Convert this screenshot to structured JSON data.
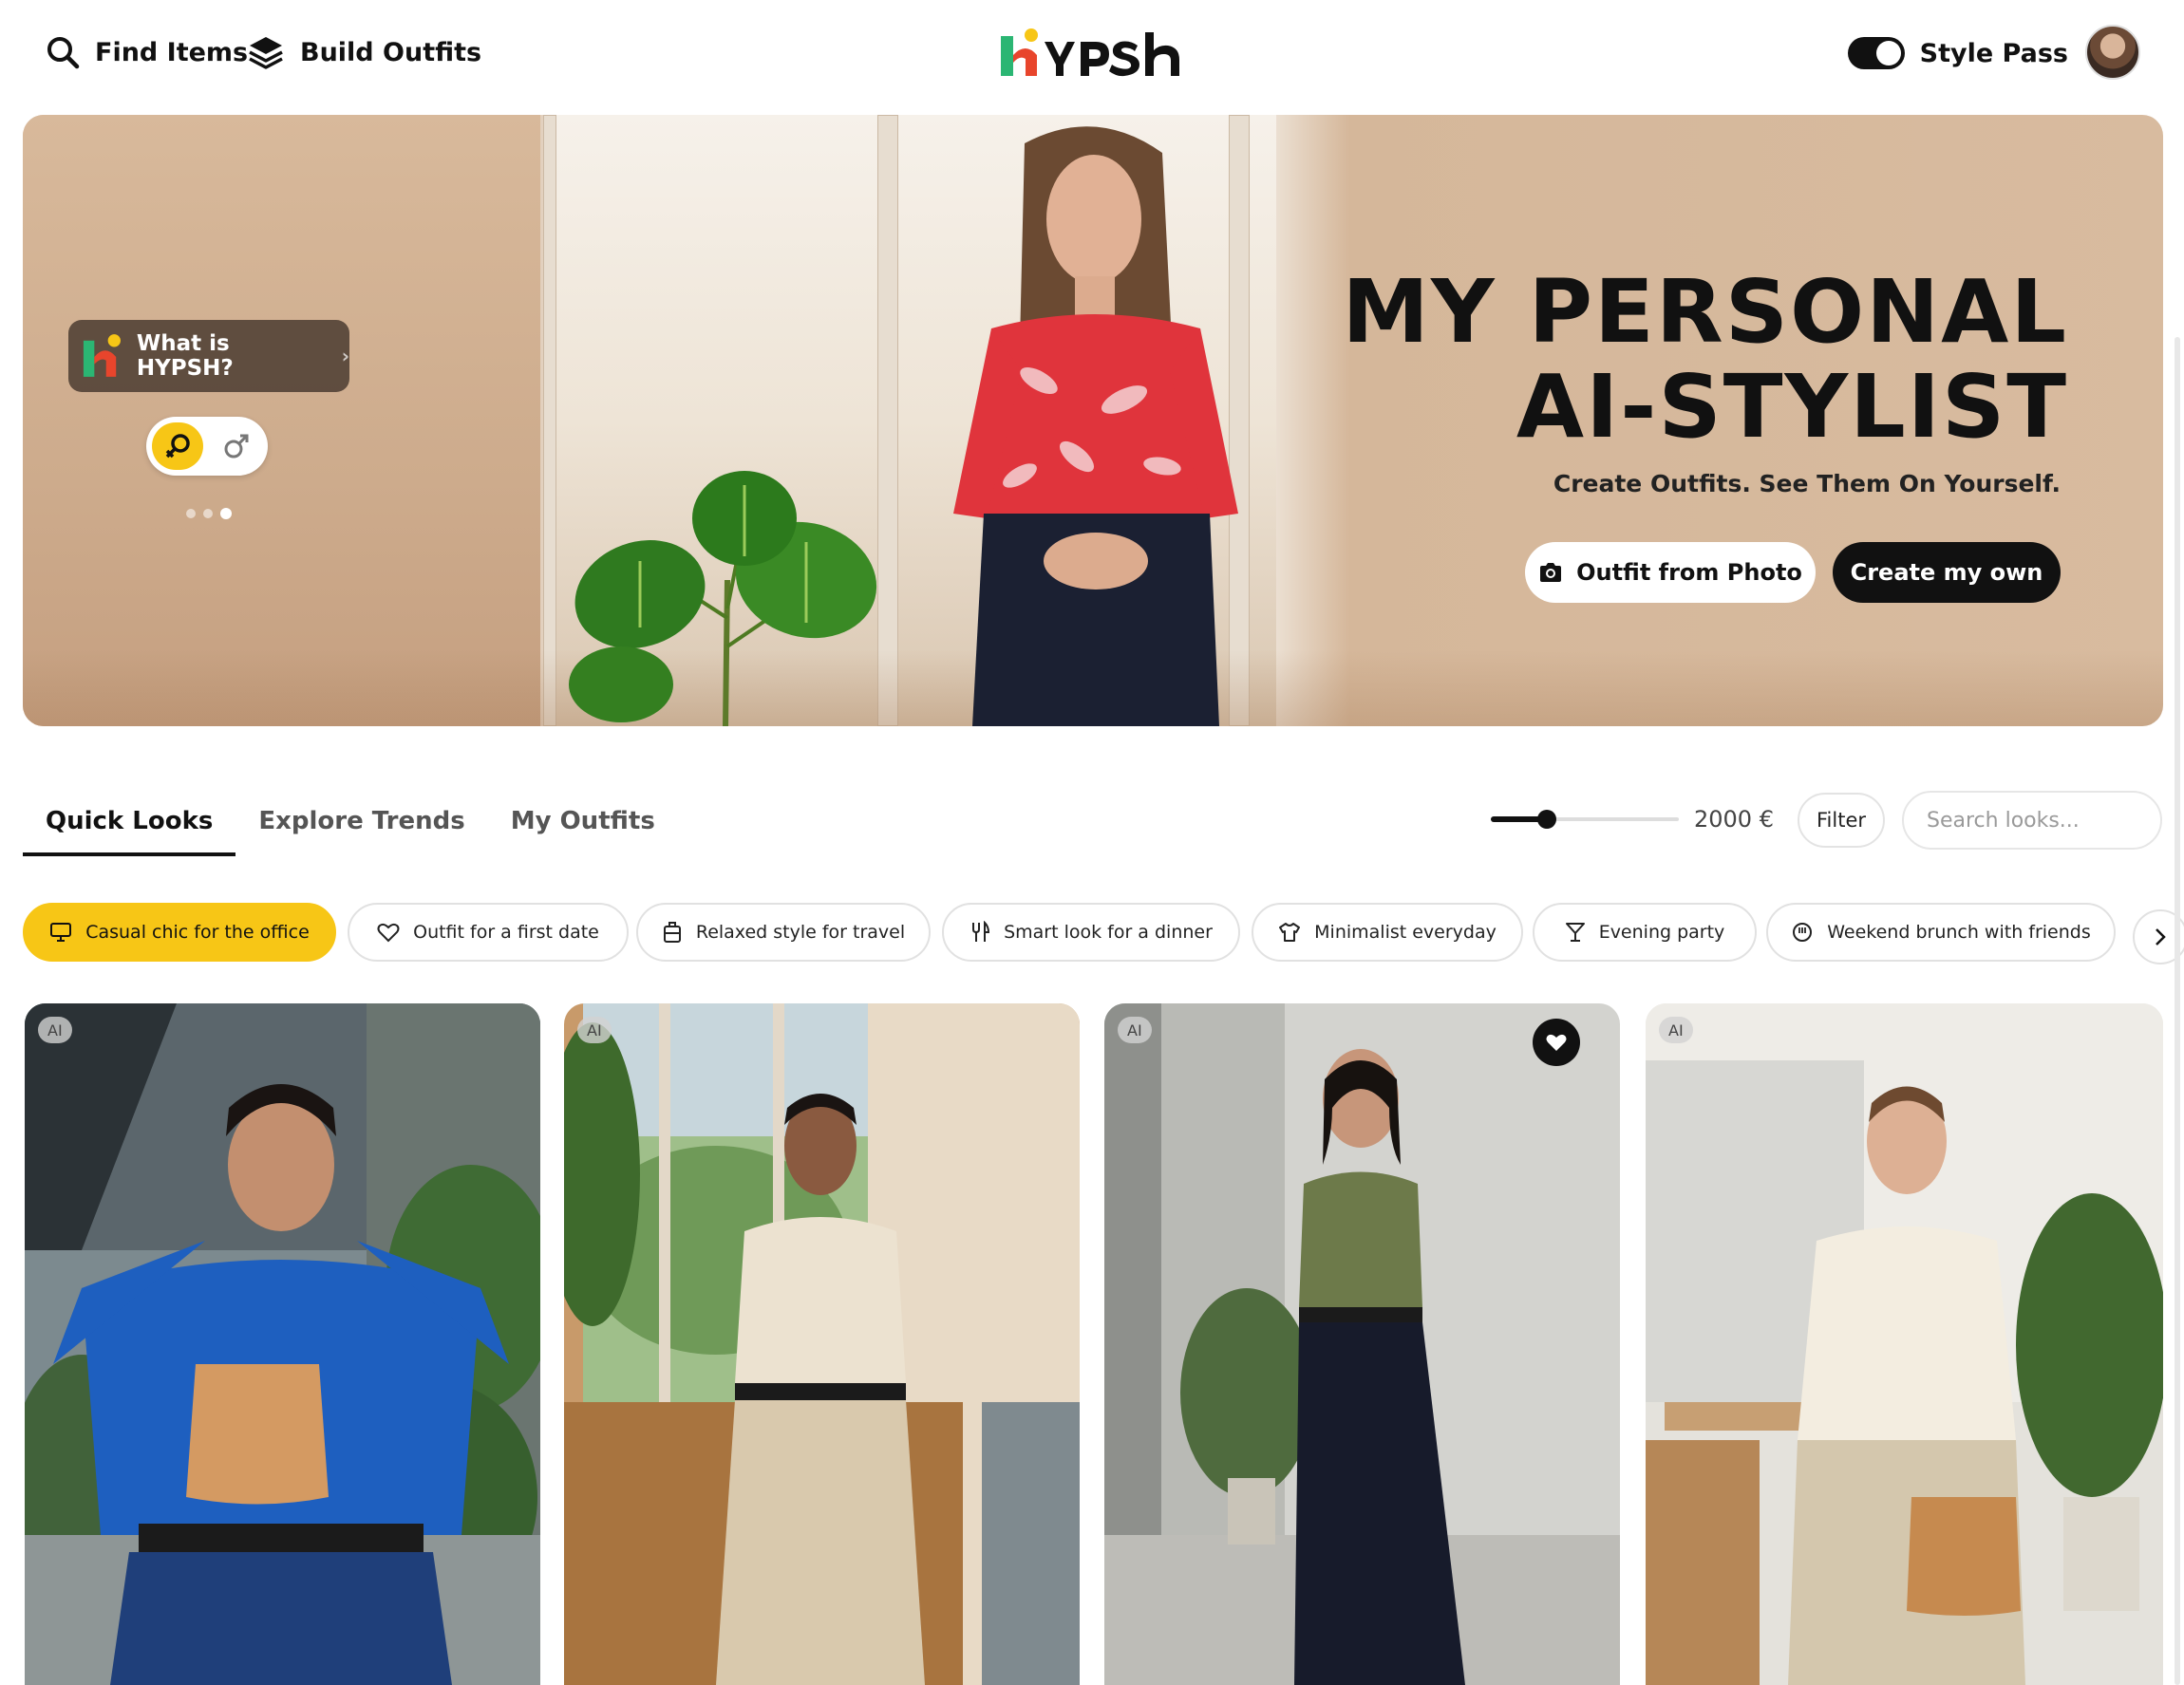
{
  "header": {
    "find_items": "Find Items",
    "build_outfits": "Build Outfits",
    "style_pass": "Style Pass",
    "style_pass_enabled": true,
    "icons": {
      "find": "search-icon",
      "build": "layers-icon"
    }
  },
  "hero": {
    "what_is": "What is HYPSH?",
    "title_line1": "MY PERSONAL",
    "title_line2": "AI-STYLIST",
    "subtitle": "Create Outfits. See Them On Yourself.",
    "btn_photo": "Outfit from Photo",
    "btn_own": "Create my own",
    "gender_selected": "female",
    "carousel": {
      "count": 3,
      "active": 3
    }
  },
  "tabs": [
    "Quick Looks",
    "Explore Trends",
    "My Outfits"
  ],
  "active_tab": "Quick Looks",
  "price": {
    "label": "2000 €",
    "fraction": 0.3
  },
  "filter_label": "Filter",
  "search": {
    "placeholder": "Search looks...",
    "value": ""
  },
  "chips": [
    {
      "label": "Casual chic for the office",
      "icon": "monitor-icon",
      "active": true
    },
    {
      "label": "Outfit for a first date",
      "icon": "heart-icon",
      "active": false
    },
    {
      "label": "Relaxed style for travel",
      "icon": "luggage-icon",
      "active": false
    },
    {
      "label": "Smart look for a dinner",
      "icon": "cutlery-icon",
      "active": false
    },
    {
      "label": "Minimalist everyday",
      "icon": "shirt-icon",
      "active": false
    },
    {
      "label": "Evening party",
      "icon": "cocktail-icon",
      "active": false
    },
    {
      "label": "Weekend brunch with friends",
      "icon": "coffee-icon",
      "active": false
    }
  ],
  "cards": [
    {
      "badge": "AI",
      "favorited": false
    },
    {
      "badge": "AI",
      "favorited": false
    },
    {
      "badge": "AI",
      "favorited": true
    },
    {
      "badge": "AI",
      "favorited": false
    }
  ],
  "colors": {
    "accent": "#f7c616",
    "dark": "#111111",
    "logo_red": "#e8452c",
    "logo_green": "#2bb673",
    "logo_yellow": "#f7c616"
  }
}
